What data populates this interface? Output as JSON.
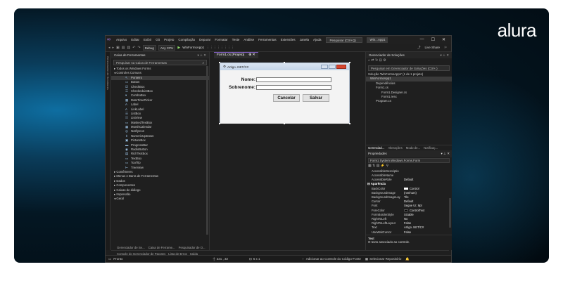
{
  "brand": {
    "logo": "alura"
  },
  "menubar": {
    "items": [
      "Arquivo",
      "Editar",
      "Exibir",
      "Git",
      "Projeto",
      "Compilação",
      "Depurar",
      "Formatar",
      "Teste",
      "Análise",
      "Ferramentas",
      "Extensões",
      "Janela",
      "Ajuda"
    ],
    "search": "Pesquisar (Ctrl+Q)",
    "solution_name": "Win...App1"
  },
  "toolbar": {
    "config": "Debug",
    "platform": "Any CPU",
    "run_target": "WinFormsApp1",
    "live_share": "Live Share"
  },
  "left_strip": {
    "label": "Gerenciador de Servidores"
  },
  "toolbox": {
    "title": "Caixa de Ferramentas",
    "search_placeholder": "Pesquisar na Caixa de Ferramentas",
    "groups_top": [
      "▸ Todos os Windows Forms",
      "◂ Controles Comuns"
    ],
    "controls": [
      "Ponteiro",
      "Button",
      "CheckBox",
      "CheckedListBox",
      "ComboBox",
      "DateTimePicker",
      "Label",
      "LinkLabel",
      "ListBox",
      "ListView",
      "MaskedTextBox",
      "MonthCalendar",
      "NotifyIcon",
      "NumericUpDown",
      "PictureBox",
      "ProgressBar",
      "RadioButton",
      "RichTextBox",
      "TextBox",
      "ToolTip",
      "TreeView"
    ],
    "groups_bottom": [
      "▸ Contêineres",
      "▸ Menus e Barra de Ferramentas",
      "▸ Dados",
      "▸ Componentes",
      "▸ Caixas de diálogo",
      "▸ Impressão",
      "◂ Geral"
    ]
  },
  "bottom_tabs": {
    "upper": [
      "Gerenciador de Se...",
      "Caixa de Ferrame...",
      "Pesquisador de O..."
    ],
    "lower": [
      "Console do Gerenciador de Pacotes",
      "Lista de Erros",
      "Saída"
    ]
  },
  "editor": {
    "tab_label": "Form1.cs [Projeto]",
    "form_title": "Artigo .NET/C#",
    "labels": {
      "name": "Nome:",
      "surname": "Sobrenome:"
    },
    "buttons": {
      "cancel": "Cancelar",
      "save": "Salvar"
    }
  },
  "solution_explorer": {
    "title": "Gerenciador de Soluções",
    "search": "Pesquisar em Gerenciador de Soluções (Ctrl+;)",
    "items": [
      "Solução 'WinFormsApp1' (1 de 1 projeto)",
      "WinFormsApp1",
      "Dependências",
      "Form1.cs",
      "Form1.Designer.cs",
      "Form1.resx",
      "Program.cs"
    ],
    "tabs": [
      "Gerenciad...",
      "Alterações",
      "Modo de...",
      "Notificaç..."
    ]
  },
  "properties": {
    "title": "Propriedades",
    "selected": "Form1  System.Windows.Forms.Form",
    "rows_top": [
      {
        "name": "AccessibleDescriptio",
        "value": ""
      },
      {
        "name": "AccessibleName",
        "value": ""
      },
      {
        "name": "AccessibleRole",
        "value": "Default"
      }
    ],
    "category": "Aparência",
    "rows": [
      {
        "name": "BackColor",
        "value": "Control"
      },
      {
        "name": "BackgroundImage",
        "value": "(nenhum)"
      },
      {
        "name": "BackgroundImageLay",
        "value": "Tile"
      },
      {
        "name": "Cursor",
        "value": "Default"
      },
      {
        "name": "Font",
        "value": "Segoe UI; 9pt"
      },
      {
        "name": "ForeColor",
        "value": "ControlText"
      },
      {
        "name": "FormBorderStyle",
        "value": "Sizable"
      },
      {
        "name": "RightToLeft",
        "value": "No"
      },
      {
        "name": "RightToLeftLayout",
        "value": "False"
      },
      {
        "name": "Text",
        "value": "Artigo .NET/C#"
      },
      {
        "name": "UseWaitCursor",
        "value": "False"
      }
    ],
    "desc_title": "Text",
    "desc_text": "O texto associado ao controle."
  },
  "statusbar": {
    "ready": "Pronto",
    "position": "221 , 32",
    "size": "6 x 1",
    "source_control": "Adicionar ao Controle do Código-Fonte",
    "repo": "Selecionar Repositório"
  }
}
